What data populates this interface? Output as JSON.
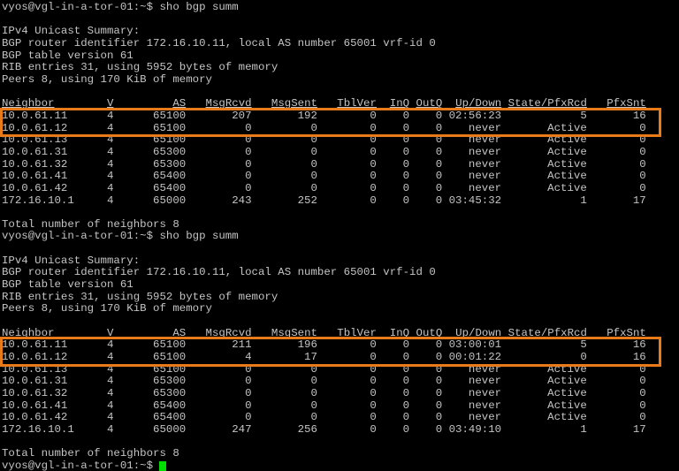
{
  "terminal": {
    "colors": {
      "background": "#000000",
      "foreground": "#c4c4c4",
      "cursor": "#00e000",
      "highlight_border": "#e87a1a"
    },
    "prompt": "vyos@vgl-in-a-tor-01:~$",
    "command": "sho bgp summ",
    "sessions": [
      {
        "summary_lines": [
          "IPv4 Unicast Summary:",
          "BGP router identifier 172.16.10.11, local AS number 65001 vrf-id 0",
          "BGP table version 61",
          "RIB entries 31, using 5952 bytes of memory",
          "Peers 8, using 170 KiB of memory"
        ],
        "table": {
          "headers": [
            "Neighbor",
            "V",
            "AS",
            "MsgRcvd",
            "MsgSent",
            "TblVer",
            "InQ",
            "OutQ",
            "Up/Down",
            "State/PfxRcd",
            "PfxSnt"
          ],
          "rows": [
            [
              "10.0.61.11",
              "4",
              "65100",
              "207",
              "192",
              "0",
              "0",
              "0",
              "02:56:23",
              "5",
              "16"
            ],
            [
              "10.0.61.12",
              "4",
              "65100",
              "0",
              "0",
              "0",
              "0",
              "0",
              "never",
              "Active",
              "0"
            ],
            [
              "10.0.61.13",
              "4",
              "65100",
              "0",
              "0",
              "0",
              "0",
              "0",
              "never",
              "Active",
              "0"
            ],
            [
              "10.0.61.31",
              "4",
              "65300",
              "0",
              "0",
              "0",
              "0",
              "0",
              "never",
              "Active",
              "0"
            ],
            [
              "10.0.61.32",
              "4",
              "65300",
              "0",
              "0",
              "0",
              "0",
              "0",
              "never",
              "Active",
              "0"
            ],
            [
              "10.0.61.41",
              "4",
              "65400",
              "0",
              "0",
              "0",
              "0",
              "0",
              "never",
              "Active",
              "0"
            ],
            [
              "10.0.61.42",
              "4",
              "65400",
              "0",
              "0",
              "0",
              "0",
              "0",
              "never",
              "Active",
              "0"
            ],
            [
              "172.16.10.1",
              "4",
              "65000",
              "243",
              "252",
              "0",
              "0",
              "0",
              "03:45:32",
              "1",
              "17"
            ]
          ],
          "highlighted_rows": [
            0,
            1
          ]
        },
        "total_line": "Total number of neighbors 8"
      },
      {
        "summary_lines": [
          "IPv4 Unicast Summary:",
          "BGP router identifier 172.16.10.11, local AS number 65001 vrf-id 0",
          "BGP table version 61",
          "RIB entries 31, using 5952 bytes of memory",
          "Peers 8, using 170 KiB of memory"
        ],
        "table": {
          "headers": [
            "Neighbor",
            "V",
            "AS",
            "MsgRcvd",
            "MsgSent",
            "TblVer",
            "InQ",
            "OutQ",
            "Up/Down",
            "State/PfxRcd",
            "PfxSnt"
          ],
          "rows": [
            [
              "10.0.61.11",
              "4",
              "65100",
              "211",
              "196",
              "0",
              "0",
              "0",
              "03:00:01",
              "5",
              "16"
            ],
            [
              "10.0.61.12",
              "4",
              "65100",
              "4",
              "17",
              "0",
              "0",
              "0",
              "00:01:22",
              "0",
              "16"
            ],
            [
              "10.0.61.13",
              "4",
              "65100",
              "0",
              "0",
              "0",
              "0",
              "0",
              "never",
              "Active",
              "0"
            ],
            [
              "10.0.61.31",
              "4",
              "65300",
              "0",
              "0",
              "0",
              "0",
              "0",
              "never",
              "Active",
              "0"
            ],
            [
              "10.0.61.32",
              "4",
              "65300",
              "0",
              "0",
              "0",
              "0",
              "0",
              "never",
              "Active",
              "0"
            ],
            [
              "10.0.61.41",
              "4",
              "65400",
              "0",
              "0",
              "0",
              "0",
              "0",
              "never",
              "Active",
              "0"
            ],
            [
              "10.0.61.42",
              "4",
              "65400",
              "0",
              "0",
              "0",
              "0",
              "0",
              "never",
              "Active",
              "0"
            ],
            [
              "172.16.10.1",
              "4",
              "65000",
              "247",
              "256",
              "0",
              "0",
              "0",
              "03:49:10",
              "1",
              "17"
            ]
          ],
          "highlighted_rows": [
            0,
            1
          ]
        },
        "total_line": "Total number of neighbors 8"
      }
    ]
  }
}
